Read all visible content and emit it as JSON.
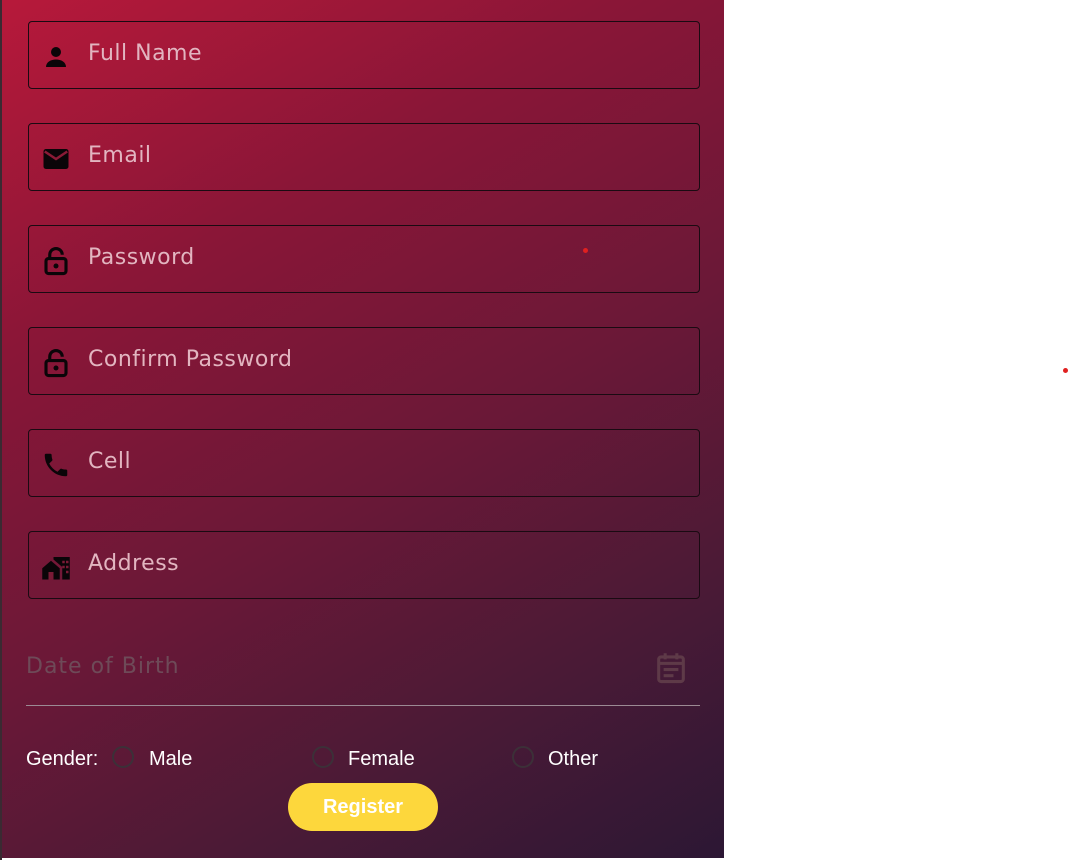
{
  "form": {
    "fields": [
      {
        "label": "Full Name",
        "icon": "person-icon"
      },
      {
        "label": "Email",
        "icon": "email-icon"
      },
      {
        "label": "Password",
        "icon": "lock-icon"
      },
      {
        "label": "Confirm Password",
        "icon": "lock-icon"
      },
      {
        "label": "Cell",
        "icon": "phone-icon"
      },
      {
        "label": "Address",
        "icon": "home-work-icon"
      }
    ],
    "dob": {
      "label": "Date of Birth",
      "icon": "calendar-icon"
    },
    "gender": {
      "label": "Gender:",
      "options": [
        "Male",
        "Female",
        "Other"
      ],
      "selected": null
    },
    "register_label": "Register"
  },
  "colors": {
    "gradient_start": "#b7193a",
    "gradient_end": "#2c1734",
    "button": "#fdd73c",
    "label_text": "#e2b5c0"
  }
}
